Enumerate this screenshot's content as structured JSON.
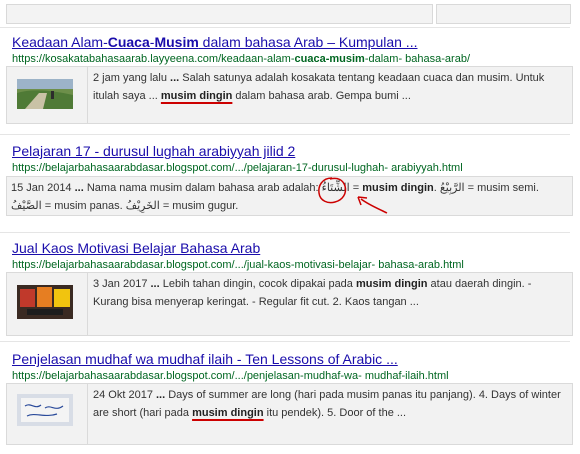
{
  "results": [
    {
      "title_pre": "Keadaan Alam-",
      "title_b1": "Cuaca",
      "title_mid": "-",
      "title_b2": "Musim",
      "title_post": " dalam bahasa Arab – Kumpulan ...",
      "url_pre": "https://kosakatabahasaarab.layyeena.com/keadaan-alam-",
      "url_b": "cuaca-musim",
      "url_post": "-dalam- bahasa-arab/",
      "snippet_a": "2 jam yang lalu",
      "snippet_b": " ... ",
      "snippet_c": "Salah satunya adalah kosakata tentang keadaan cuaca dan musim. Untuk itulah saya ... ",
      "snippet_bold": "musim dingin",
      "snippet_d": " dalam bahasa arab. Gempa bumi ..."
    },
    {
      "title": "Pelajaran 17 - durusul lughah arabiyyah jilid 2",
      "url": "https://belajarbahasaarabdasar.blogspot.com/.../pelajaran-17-durusul-lughah- arabiyyah.html",
      "snippet_a": "15 Jan 2014",
      "snippet_b": " ... ",
      "snippet_c": "Nama nama musim dalam bahasa arab adalah: ",
      "snippet_arabic1": "الشِّتَاءُ",
      "snippet_eq": " = ",
      "snippet_bold": "musim dingin",
      "snippet_d": ". ",
      "snippet_arabic2": "الرَّبِيْعُ",
      "snippet_e": " = musim semi. ",
      "snippet_arabic3": "الصَّيْفُ",
      "snippet_f": " = musim panas. ",
      "snippet_arabic4": "الخَرِيْفُ",
      "snippet_g": " = musim gugur."
    },
    {
      "title": "Jual Kaos Motivasi Belajar Bahasa Arab",
      "url": "https://belajarbahasaarabdasar.blogspot.com/.../jual-kaos-motivasi-belajar- bahasa-arab.html",
      "snippet_a": "3 Jan 2017",
      "snippet_b": " ... ",
      "snippet_c": "Lebih tahan dingin, cocok dipakai pada ",
      "snippet_bold": "musim dingin",
      "snippet_d": " atau daerah dingin. - Kurang bisa menyerap keringat. - Regular fit cut. 2. Kaos tangan ..."
    },
    {
      "title": "Penjelasan mudhaf wa mudhaf ilaih - Ten Lessons of Arabic ...",
      "url": "https://belajarbahasaarabdasar.blogspot.com/.../penjelasan-mudhaf-wa- mudhaf-ilaih.html",
      "snippet_a": "24 Okt 2017",
      "snippet_b": " ... ",
      "snippet_c": "Days of summer are long (hari pada musim panas itu panjang). 4. Days of winter are short (hari pada ",
      "snippet_bold": "musim dingin",
      "snippet_d": " itu pendek). 5. Door of the ..."
    }
  ],
  "colors": {
    "link": "#1a0dab",
    "url": "#006621",
    "annotation": "#cc0000",
    "box_bg": "#f2f2f2"
  }
}
